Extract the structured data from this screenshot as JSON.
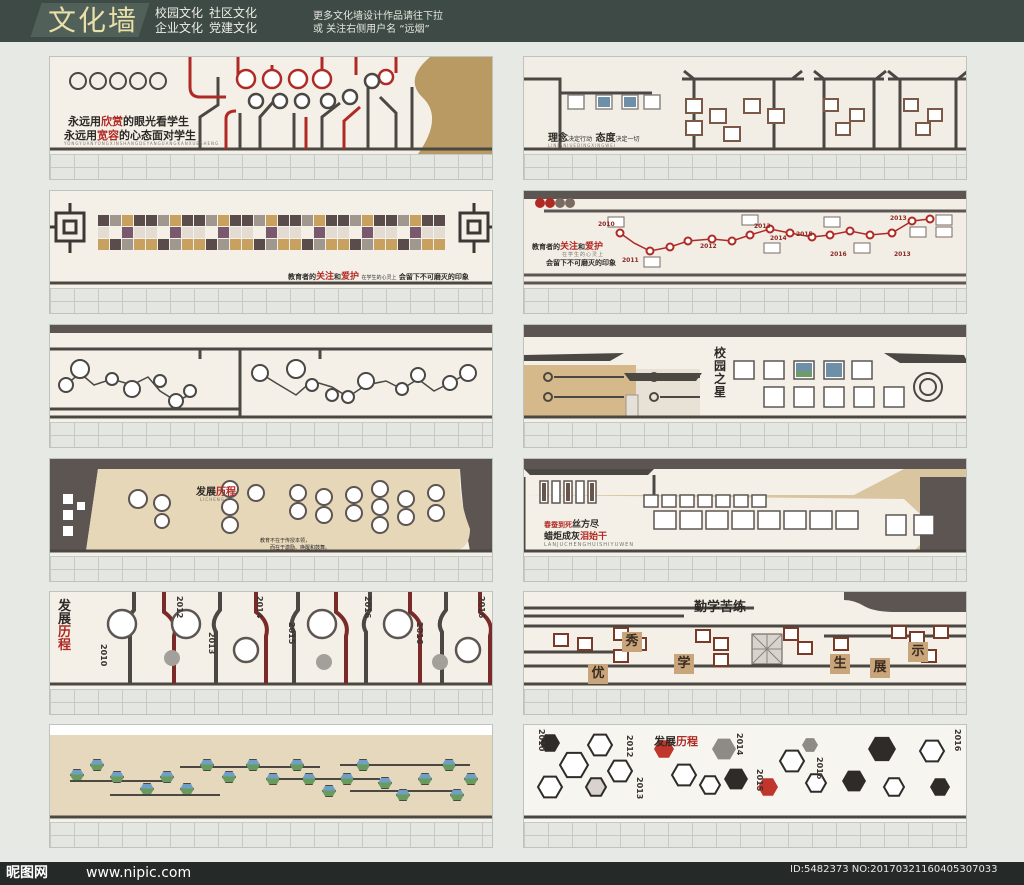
{
  "header": {
    "title": "文化墙",
    "categories": [
      "校园文化",
      "社区文化",
      "企业文化",
      "党建文化"
    ],
    "promo_line1": "更多文化墙设计作品请往下拉",
    "promo_line2": "或 关注右侧用户名 “远烟”"
  },
  "panels": {
    "p1": {
      "line1_a": "永远用",
      "line1_b": "欣赏",
      "line1_c": "的眼光看学生",
      "line2_a": "永远用",
      "line2_b": "宽容",
      "line2_c": "的心态面对学生",
      "sub": "YONGYUANYONGXINSHANGDEYANGUANGKANXUESHENG"
    },
    "p2": {
      "title_a": "理念",
      "title_b": "决定行动",
      "title_c": "态度",
      "title_d": "决定一切",
      "sub": "LINIANJUEDINGXINGWEI"
    },
    "p4": {
      "line1_a": "教育者的",
      "line1_b": "关注",
      "line1_c": "和",
      "line1_d": "爱护",
      "line2": "在学生的心灵上",
      "line3": "会留下不可磨灭的印象",
      "years": [
        "2010",
        "2011",
        "2012",
        "2013",
        "2014",
        "2015",
        "2016",
        "2013",
        "2013"
      ]
    },
    "p3": {
      "line_a": "教育者的",
      "line_b": "关注",
      "line_c": "和",
      "line_d": "爱护",
      "line_e": "在学生的心灵上",
      "line_f": "会留下不可磨灭的印象"
    },
    "p6": {
      "title": "校园之星"
    },
    "p7": {
      "title_a": "发",
      "title_b": "展",
      "title_c": "历程",
      "sub": "LICHENG",
      "text1": "教育不在于传授本领，",
      "text2": "而在于激励、唤醒和鼓舞。"
    },
    "p8": {
      "title_a": "春蚕到死",
      "title_b": "丝方尽",
      "title_c": "蜡炬成灰",
      "title_d": "泪始干",
      "sub": "LANJUCHENGHUISHIYUWEN"
    },
    "p9": {
      "title_a": "发",
      "title_b": "展",
      "title_c": "历程",
      "sub": "LICHENG",
      "years": [
        "2010",
        "2012",
        "2013",
        "2014",
        "2015",
        "2016",
        "2016",
        "2016"
      ]
    },
    "p10": {
      "title": "勤学苦练",
      "chars": [
        "优",
        "秀",
        "学",
        "生",
        "展",
        "示"
      ]
    },
    "p12": {
      "title_a": "发",
      "title_b": "展",
      "title_c": "历程",
      "years": [
        "2010",
        "2012",
        "2013",
        "2014",
        "2015",
        "2016",
        "2016"
      ]
    }
  },
  "footer": {
    "logo": "昵图网",
    "url": "www.nipic.com",
    "id": "ID:5482373 NO:20170321160405307033"
  }
}
